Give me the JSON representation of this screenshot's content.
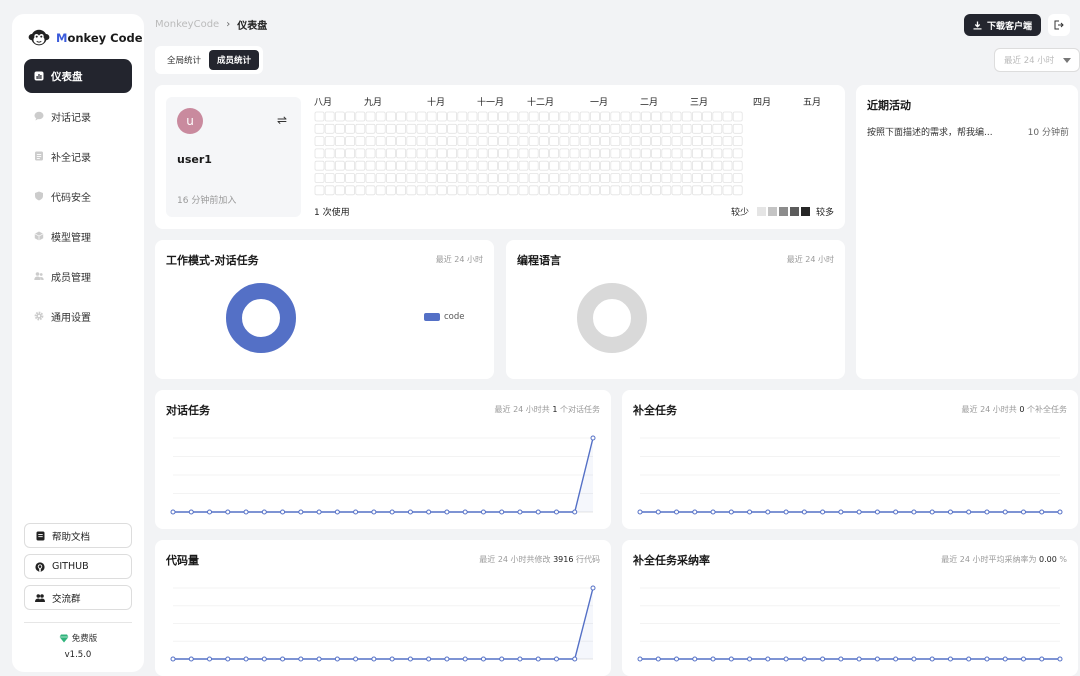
{
  "sidebar": {
    "logo": "Monkey Code",
    "items": [
      {
        "label": "仪表盘",
        "icon": "bar-chart-icon",
        "active": true
      },
      {
        "label": "对话记录",
        "icon": "chat-bubble-icon"
      },
      {
        "label": "补全记录",
        "icon": "list-icon"
      },
      {
        "label": "代码安全",
        "icon": "shield-icon"
      },
      {
        "label": "模型管理",
        "icon": "cube-icon"
      },
      {
        "label": "成员管理",
        "icon": "users-icon"
      },
      {
        "label": "通用设置",
        "icon": "gear-icon"
      }
    ],
    "help": "帮助文档",
    "github": "GITHUB",
    "community": "交流群",
    "edition": "免费版",
    "version": "v1.5.0"
  },
  "header": {
    "breadcrumb_root": "MonkeyCode",
    "breadcrumb_sep": "›",
    "breadcrumb_current": "仪表盘",
    "download_label": "下载客户端",
    "range_label": "最近 24 小时"
  },
  "tabs": [
    {
      "label": "全局统计"
    },
    {
      "label": "成员统计",
      "active": true
    }
  ],
  "user_card": {
    "avatar_letter": "u",
    "username": "user1",
    "joined": "16 分钟前加入",
    "usage": "1 次使用",
    "months": [
      "八月",
      "九月",
      "十月",
      "十一月",
      "十二月",
      "一月",
      "二月",
      "三月",
      "四月",
      "五月"
    ],
    "legend_less": "较少",
    "legend_more": "较多",
    "legend_colors": [
      "#e5e5e5",
      "#c4c4c4",
      "#8c8c8c",
      "#5c5c5c",
      "#262626"
    ]
  },
  "activity": {
    "title": "近期活动",
    "items": [
      {
        "text": "按照下面描述的需求，帮我编...",
        "time": "10 分钟前"
      }
    ]
  },
  "work_mode": {
    "title": "工作模式-对话任务",
    "range": "最近 24 小时",
    "legend": "code",
    "color": "#5470c6"
  },
  "language": {
    "title": "编程语言",
    "range": "最近 24 小时",
    "color": "#d9d9d9"
  },
  "chat_tasks": {
    "title": "对话任务",
    "sub_prefix": "最近 24 小时共",
    "sub_value": "1",
    "sub_suffix": "个对话任务"
  },
  "completion_tasks": {
    "title": "补全任务",
    "sub_prefix": "最近 24 小时共",
    "sub_value": "0",
    "sub_suffix": "个补全任务"
  },
  "code_volume": {
    "title": "代码量",
    "sub_prefix": "最近 24 小时共修改",
    "sub_value": "3916",
    "sub_suffix": "行代码"
  },
  "acceptance": {
    "title": "补全任务采纳率",
    "sub_prefix": "最近 24 小时平均采纳率为",
    "sub_value": "0.00",
    "sub_suffix": "%"
  },
  "chart_data": [
    {
      "type": "pie",
      "categories": [
        "code"
      ],
      "values": [
        1
      ],
      "title": "工作模式-对话任务"
    },
    {
      "type": "pie",
      "categories": [],
      "values": [],
      "title": "编程语言"
    },
    {
      "type": "line",
      "title": "对话任务",
      "series": [
        {
          "values": [
            0,
            0,
            0,
            0,
            0,
            0,
            0,
            0,
            0,
            0,
            0,
            0,
            0,
            0,
            0,
            0,
            0,
            0,
            0,
            0,
            0,
            0,
            0,
            1
          ]
        }
      ],
      "ylim": [
        0,
        1
      ]
    },
    {
      "type": "line",
      "title": "补全任务",
      "series": [
        {
          "values": [
            0,
            0,
            0,
            0,
            0,
            0,
            0,
            0,
            0,
            0,
            0,
            0,
            0,
            0,
            0,
            0,
            0,
            0,
            0,
            0,
            0,
            0,
            0,
            0
          ]
        }
      ],
      "ylim": [
        0,
        1
      ]
    },
    {
      "type": "line",
      "title": "代码量",
      "series": [
        {
          "values": [
            0,
            0,
            0,
            0,
            0,
            0,
            0,
            0,
            0,
            0,
            0,
            0,
            0,
            0,
            0,
            0,
            0,
            0,
            0,
            0,
            0,
            0,
            0,
            3916
          ]
        }
      ],
      "ylim": [
        0,
        3916
      ]
    },
    {
      "type": "line",
      "title": "补全任务采纳率",
      "series": [
        {
          "values": [
            0,
            0,
            0,
            0,
            0,
            0,
            0,
            0,
            0,
            0,
            0,
            0,
            0,
            0,
            0,
            0,
            0,
            0,
            0,
            0,
            0,
            0,
            0,
            0
          ]
        }
      ],
      "ylim": [
        0,
        1
      ]
    }
  ]
}
